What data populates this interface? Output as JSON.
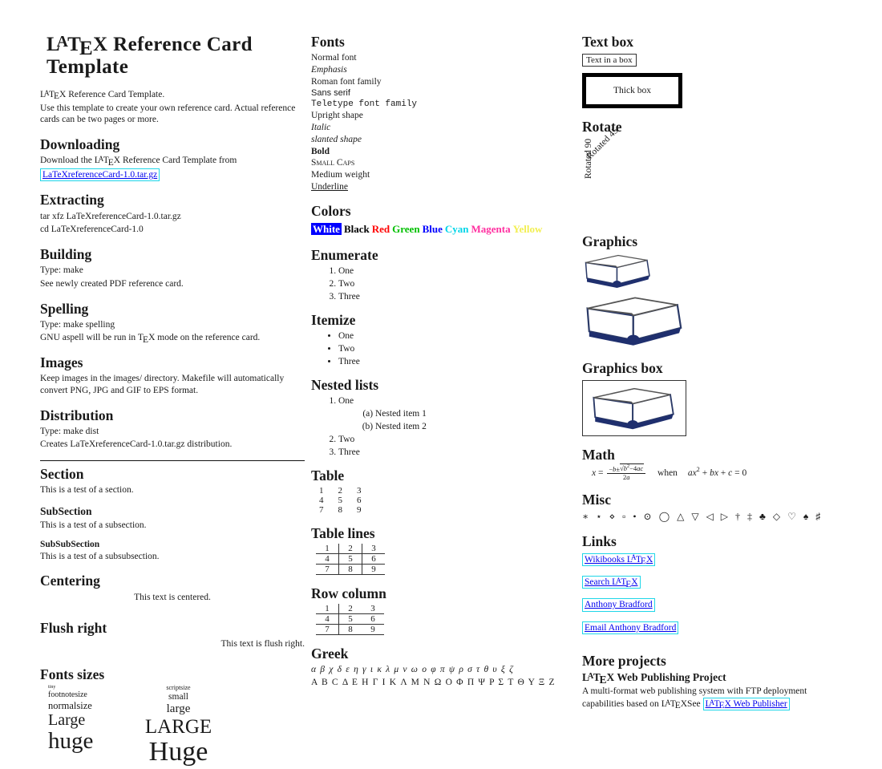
{
  "title": "LaTeX Reference Card Template",
  "left": {
    "intro": {
      "line1": "LaTeX Reference Card Template.",
      "line2": "Use this template to create your own reference card.  Actual reference cards can be two pages or more."
    },
    "downloading": {
      "heading": "Downloading",
      "text": "Download the LaTeX Reference Card Template from",
      "link": "LaTeXreferenceCard-1.0.tar.gz"
    },
    "extracting": {
      "heading": "Extracting",
      "line1": "tar xfz LaTeXreferenceCard-1.0.tar.gz",
      "line2": "cd LaTeXreferenceCard-1.0"
    },
    "building": {
      "heading": "Building",
      "line1": "Type:  make",
      "line2": "See newly created PDF reference card."
    },
    "spelling": {
      "heading": "Spelling",
      "line1": "Type:  make spelling",
      "line2": "GNU aspell will be run in TeX mode on the reference card."
    },
    "images": {
      "heading": "Images",
      "line1": "Keep images in the images/ directory.  Makefile will automatically convert PNG, JPG and GIF to EPS format."
    },
    "distribution": {
      "heading": "Distribution",
      "line1": "Type:  make dist",
      "line2": "Creates LaTeXreferenceCard-1.0.tar.gz distribution."
    },
    "section": {
      "heading": "Section",
      "text": "This is a test of a section."
    },
    "subsection": {
      "heading": "SubSection",
      "text": "This is a test of a subsection."
    },
    "subsubsection": {
      "heading": "SubSubSection",
      "text": "This is a test of a subsubsection."
    },
    "centering": {
      "heading": "Centering",
      "text": "This text is centered."
    },
    "flushright": {
      "heading": "Flush right",
      "text": "This text is flush right."
    },
    "fontsizes": {
      "heading": "Fonts sizes",
      "left_col": [
        "tiny",
        "footnotesize",
        "normalsize",
        "Large",
        "huge"
      ],
      "right_col": [
        "scriptsize",
        "small",
        "large",
        "LARGE",
        "Huge"
      ]
    }
  },
  "mid": {
    "fonts": {
      "heading": "Fonts",
      "samples": [
        "Normal font",
        "Emphasis",
        "Roman font family",
        "Sans serif",
        "Teletype font family",
        "Upright shape",
        "Italic",
        "slanted shape",
        "Bold",
        "Small Caps",
        "Medium weight",
        "Underline"
      ]
    },
    "colors": {
      "heading": "Colors",
      "names": [
        "White",
        "Black",
        "Red",
        "Green",
        "Blue",
        "Cyan",
        "Magenta",
        "Yellow"
      ],
      "hex": {
        "white_fg": "#ffffff",
        "white_bg": "#0000ff",
        "black": "#000000",
        "red": "#ff0000",
        "green": "#00c000",
        "blue": "#0000ff",
        "cyan": "#00d5e8",
        "magenta": "#ff2fa0",
        "yellow": "#f2ef52"
      }
    },
    "enumerate": {
      "heading": "Enumerate",
      "items": [
        "One",
        "Two",
        "Three"
      ]
    },
    "itemize": {
      "heading": "Itemize",
      "items": [
        "One",
        "Two",
        "Three"
      ]
    },
    "nested": {
      "heading": "Nested lists",
      "item1": "One",
      "sub": [
        "Nested item 1",
        "Nested item 2"
      ],
      "item2": "Two",
      "item3": "Three"
    },
    "table": {
      "heading": "Table",
      "rows": [
        [
          "1",
          "2",
          "3"
        ],
        [
          "4",
          "5",
          "6"
        ],
        [
          "7",
          "8",
          "9"
        ]
      ]
    },
    "table_lines": {
      "heading": "Table lines",
      "rows": [
        [
          "1",
          "2",
          "3"
        ],
        [
          "4",
          "5",
          "6"
        ],
        [
          "7",
          "8",
          "9"
        ]
      ]
    },
    "row_column": {
      "heading": "Row column",
      "rows": [
        [
          "1",
          "2",
          "3"
        ],
        [
          "4",
          "5",
          "6"
        ],
        [
          "7",
          "8",
          "9"
        ]
      ]
    },
    "greek": {
      "heading": "Greek",
      "lower": "α β χ δ ε η γ ι κ λ μ ν ω ο φ π ψ ρ σ τ θ υ ξ ζ",
      "upper": "A B C Δ E H Γ I K Λ M N Ω O Φ Π Ψ P Σ T Θ Υ Ξ Z"
    }
  },
  "right": {
    "textbox": {
      "heading": "Text box",
      "thin": "Text in a box",
      "thick": "Thick box"
    },
    "rotate": {
      "heading": "Rotate",
      "r45": "Rotated 45",
      "r90": "Rotated 90"
    },
    "graphics": {
      "heading": "Graphics",
      "alt": "open book"
    },
    "graphics_box": {
      "heading": "Graphics box",
      "alt": "open book"
    },
    "math": {
      "heading": "Math",
      "lhs_var": "x",
      "eq": "=",
      "num": "−b±√(b²−4ac)",
      "den": "2a",
      "when": "when",
      "rhs": "ax² + bx + c = 0"
    },
    "misc": {
      "heading": "Misc",
      "symbols": "∗ ⋆ ⋄ ▫ • ⊙ ◯ △ ▽ ◁ ▷ † ‡ ♣ ◇ ♡ ♠ ♯"
    },
    "links": {
      "heading": "Links",
      "items": [
        "Wikibooks LaTeX",
        "Search LaTeX",
        "Anthony Bradford",
        "Email Anthony Bradford"
      ]
    },
    "more": {
      "heading": "More projects",
      "subheading": "LaTeX Web Publishing Project",
      "text": "A multi-format web publishing system with FTP deployment capabilities based on LaTeXSee",
      "link": "LaTeX Web Publisher"
    }
  }
}
